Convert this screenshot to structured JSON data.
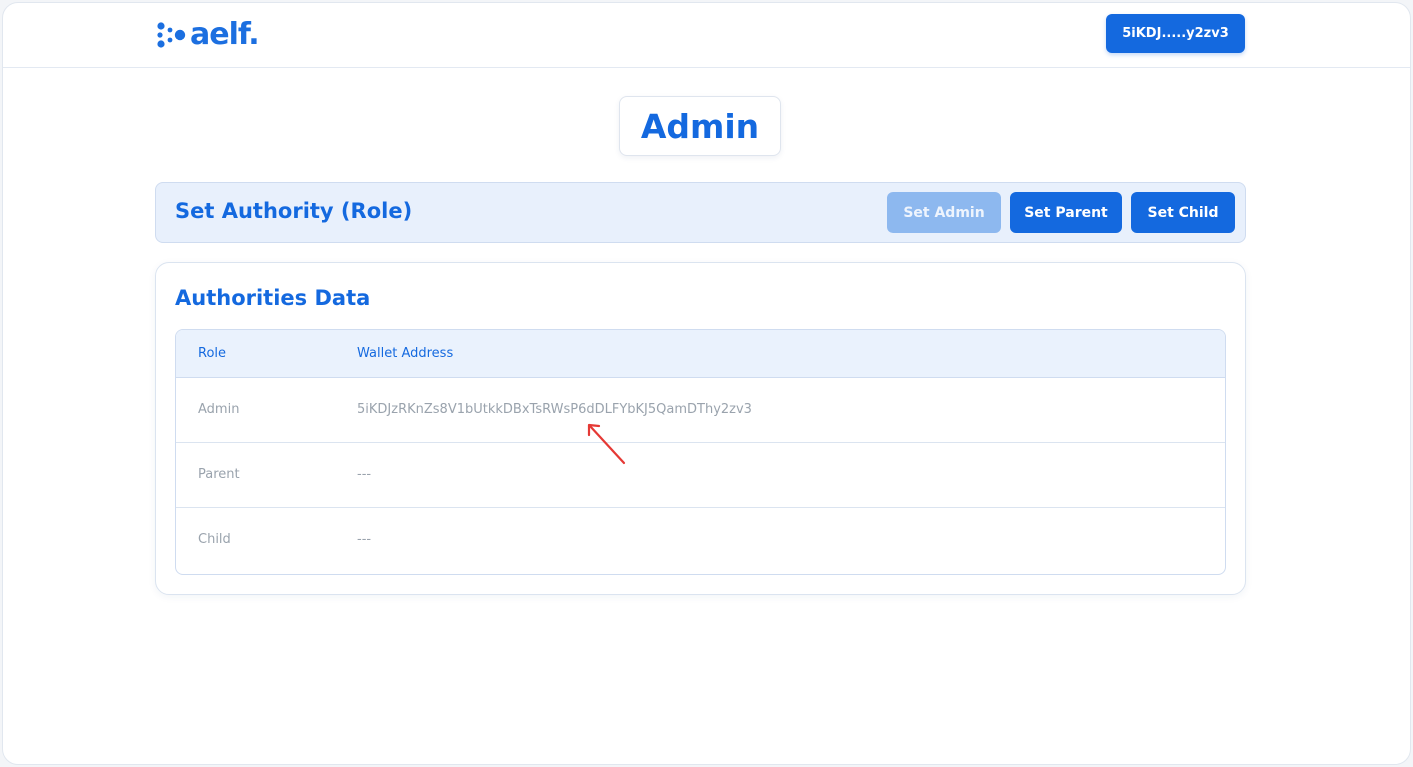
{
  "header": {
    "logo_text": "aelf.",
    "wallet_label": "5iKDJ.....y2zv3"
  },
  "page": {
    "title": "Admin"
  },
  "authority": {
    "title": "Set Authority (Role)",
    "buttons": {
      "set_admin": "Set Admin",
      "set_parent": "Set Parent",
      "set_child": "Set Child"
    }
  },
  "authorities_data": {
    "title": "Authorities Data",
    "columns": [
      "Role",
      "Wallet Address"
    ],
    "rows": [
      {
        "role": "Admin",
        "address": "5iKDJzRKnZs8V1bUtkkDBxTsRWsP6dDLFYbKJ5QamDThy2zv3"
      },
      {
        "role": "Parent",
        "address": "---"
      },
      {
        "role": "Child",
        "address": "---"
      }
    ]
  },
  "colors": {
    "brand_blue": "#1469df",
    "disabled_blue": "#8db8ef",
    "annotation_red": "#e53935"
  }
}
